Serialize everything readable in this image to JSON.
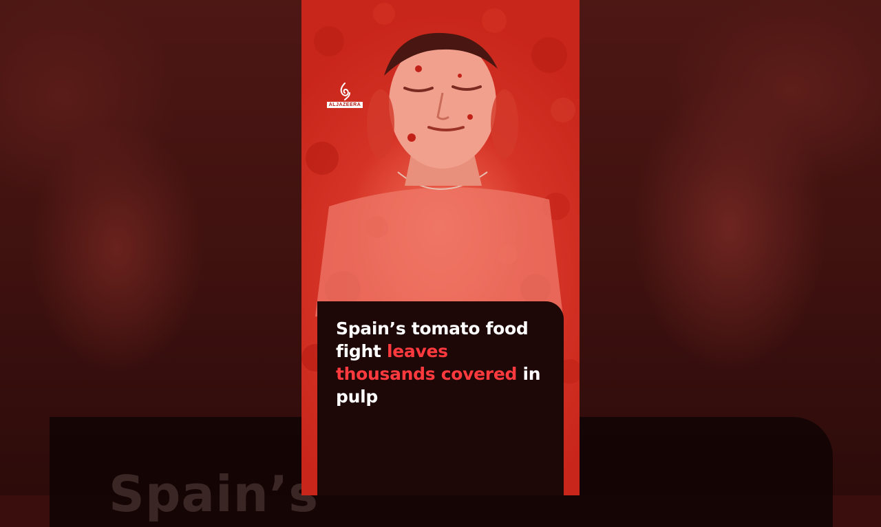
{
  "video": {
    "source_logo": {
      "icon": "al-jazeera-logo-icon",
      "label": "ALJAZEERA"
    },
    "headline": {
      "part1": "Spain’s tomato food fight ",
      "highlight": "leaves thousands covered",
      "part2": " in pulp",
      "highlight_color": "#ff3a3e"
    },
    "background_text": "Spain’s"
  }
}
